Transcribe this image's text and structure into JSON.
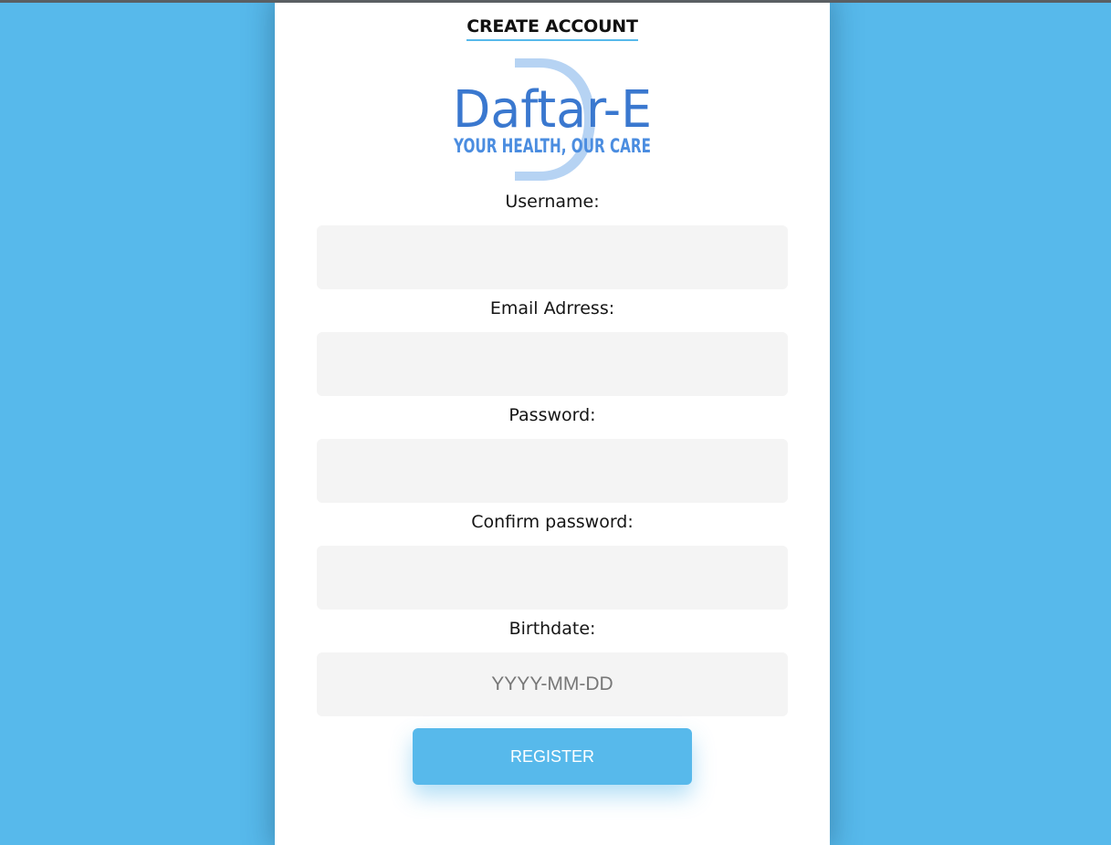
{
  "form": {
    "title": "CREATE ACCOUNT",
    "logo": {
      "name": "Daftar-E",
      "tagline": "YOUR HEALTH, OUR CARE"
    },
    "fields": [
      {
        "label": "Username:",
        "value": "",
        "placeholder": ""
      },
      {
        "label": "Email Adrress:",
        "value": "",
        "placeholder": ""
      },
      {
        "label": "Password:",
        "value": "",
        "placeholder": ""
      },
      {
        "label": "Confirm password:",
        "value": "",
        "placeholder": ""
      },
      {
        "label": "Birthdate:",
        "value": "",
        "placeholder": "YYYY-MM-DD"
      }
    ],
    "register_label": "REGISTER"
  },
  "colors": {
    "background": "#57b9eb",
    "card": "#ffffff",
    "input_bg": "#f4f4f4",
    "button": "#57b9eb",
    "logo_text": "#3a78cf",
    "logo_tagline": "#4b8de0",
    "logo_mark": "#b6d3f3"
  }
}
